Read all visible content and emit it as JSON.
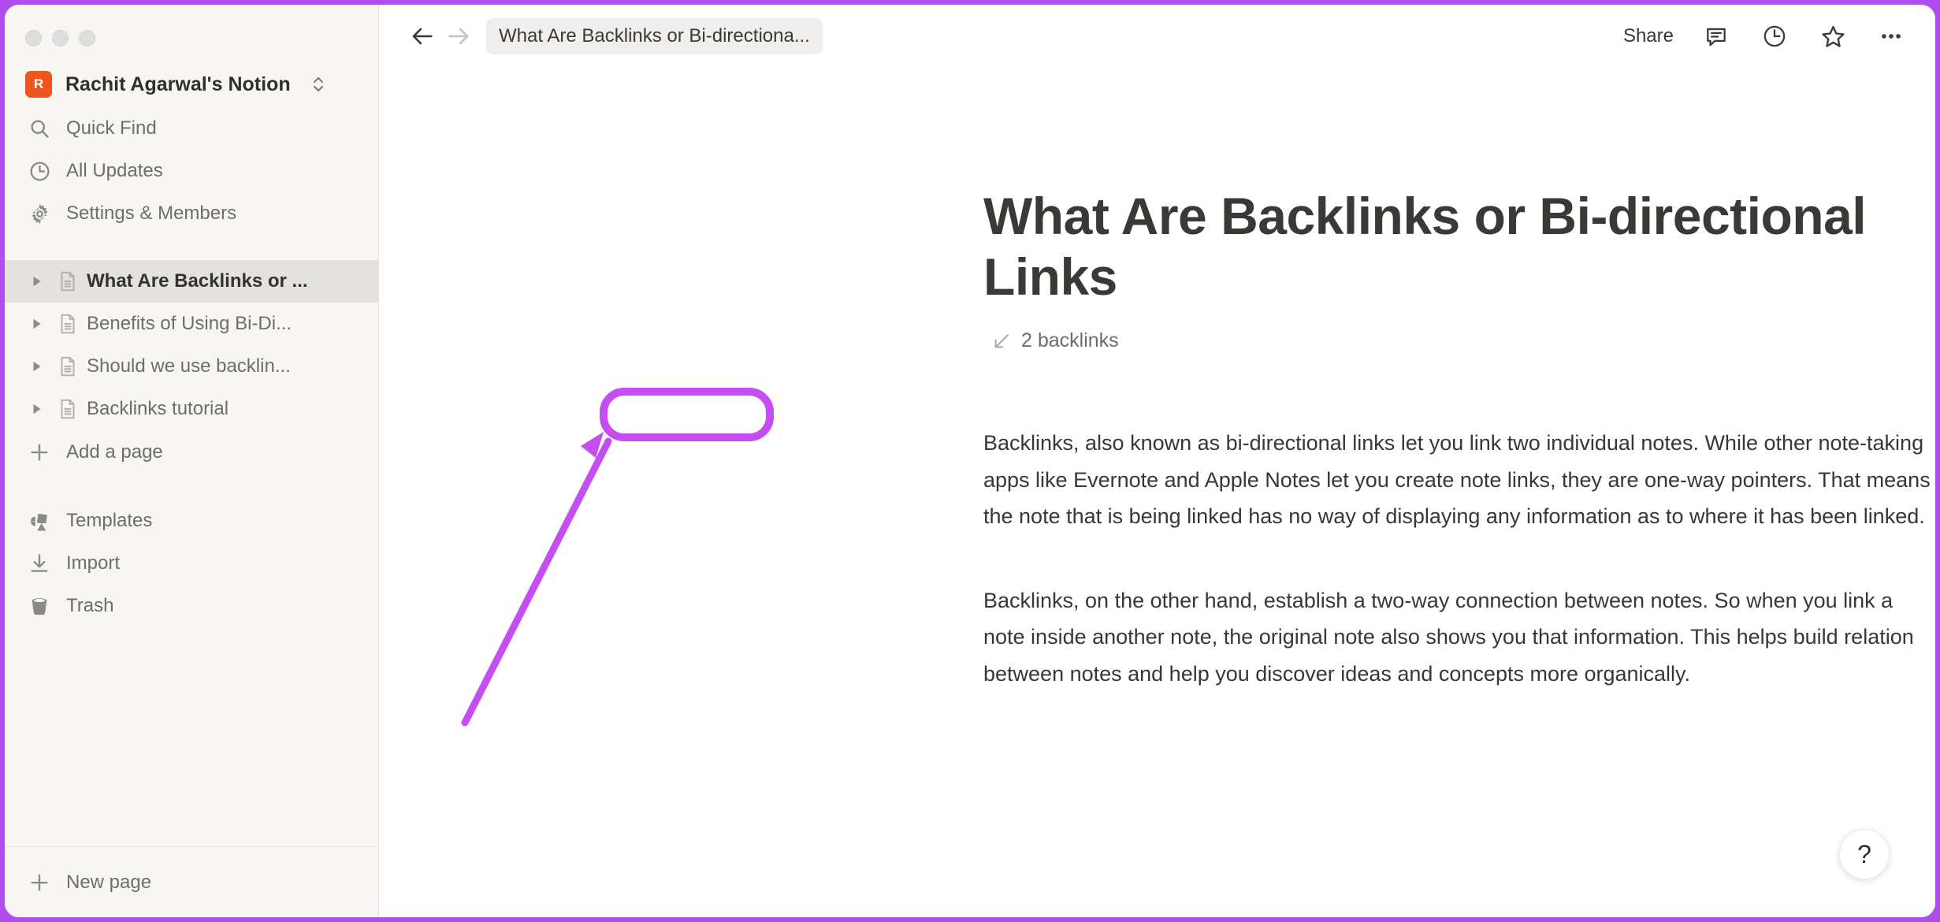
{
  "window": {
    "traffic_lights": [
      "close",
      "minimize",
      "zoom"
    ]
  },
  "sidebar": {
    "workspace": {
      "avatar_letter": "R",
      "avatar_color": "#f0551f",
      "name": "Rachit Agarwal's Notion",
      "switcher_icon": "chevron-up-down-icon"
    },
    "nav": [
      {
        "icon": "search-icon",
        "label": "Quick Find"
      },
      {
        "icon": "clock-icon",
        "label": "All Updates"
      },
      {
        "icon": "gear-icon",
        "label": "Settings & Members"
      }
    ],
    "pages": [
      {
        "icon": "page-icon",
        "toggle": "triangle-right-icon",
        "label": "What Are Backlinks or ...",
        "active": true
      },
      {
        "icon": "page-icon",
        "toggle": "triangle-right-icon",
        "label": "Benefits of Using Bi-Di...",
        "active": false
      },
      {
        "icon": "page-icon",
        "toggle": "triangle-right-icon",
        "label": "Should we use backlin...",
        "active": false
      },
      {
        "icon": "page-icon",
        "toggle": "triangle-right-icon",
        "label": "Backlinks tutorial",
        "active": false
      }
    ],
    "add_page": {
      "icon": "plus-icon",
      "label": "Add a page"
    },
    "utilities": [
      {
        "icon": "templates-icon",
        "label": "Templates"
      },
      {
        "icon": "import-icon",
        "label": "Import"
      },
      {
        "icon": "trash-icon",
        "label": "Trash"
      }
    ],
    "new_page": {
      "icon": "plus-icon",
      "label": "New page"
    }
  },
  "topbar": {
    "back_icon": "arrow-left-icon",
    "forward_icon": "arrow-right-icon",
    "breadcrumb": "What Are Backlinks or Bi-directiona...",
    "share_label": "Share",
    "icons": [
      "comment-icon",
      "history-clock-icon",
      "star-icon",
      "more-dots-icon"
    ]
  },
  "document": {
    "title": "What Are Backlinks or Bi-directional Links",
    "backlinks": {
      "icon": "arrow-down-left-icon",
      "label": "2 backlinks",
      "count": 2
    },
    "paragraphs": [
      "Backlinks, also known as bi-directional links let you link two individual notes. While other note-taking apps like Evernote and Apple Notes let you create note links, they are one-way pointers. That means the note that is being linked has no way of displaying any information as to where it has been linked.",
      "Backlinks, on the other hand, establish a two-way connection between notes. So when you link a note inside another note, the original note also shows you that information. This helps build relation between notes and help you discover ideas and concepts more organically."
    ]
  },
  "help_button": {
    "label": "?",
    "icon": "question-mark-icon"
  },
  "annotation": {
    "color": "#c44ef2",
    "target": "2 backlinks",
    "shapes": [
      "rounded-rect-highlight",
      "arrow-pointer"
    ]
  }
}
